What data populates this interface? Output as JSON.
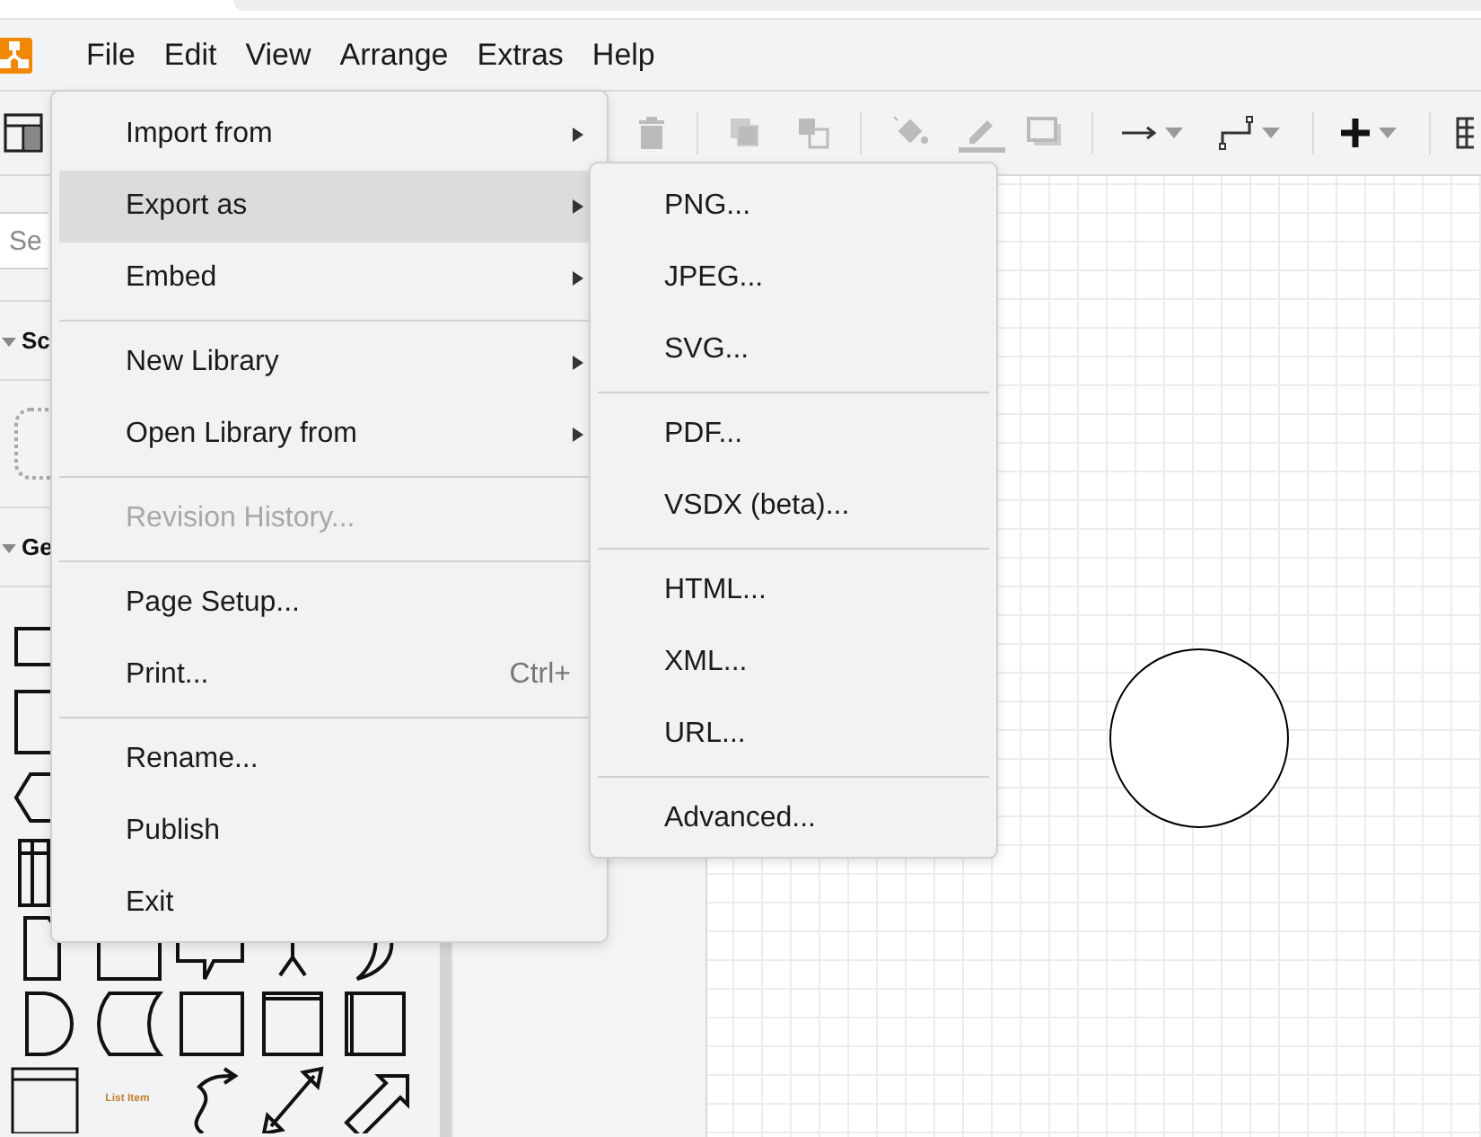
{
  "menubar": {
    "items": [
      {
        "label": "File"
      },
      {
        "label": "Edit"
      },
      {
        "label": "View"
      },
      {
        "label": "Arrange"
      },
      {
        "label": "Extras"
      },
      {
        "label": "Help"
      }
    ]
  },
  "sidebar": {
    "search": {
      "placeholder": "Se"
    },
    "sections": [
      {
        "title": "Sc",
        "expanded": true
      },
      {
        "title": "Ge",
        "expanded": true
      }
    ],
    "shape_label": "List Item"
  },
  "file_menu": {
    "items": [
      {
        "kind": "item",
        "label": "Import from",
        "submenu": true,
        "selected": false,
        "disabled": false
      },
      {
        "kind": "item",
        "label": "Export as",
        "submenu": true,
        "selected": true,
        "disabled": false
      },
      {
        "kind": "item",
        "label": "Embed",
        "submenu": true,
        "selected": false,
        "disabled": false
      },
      {
        "kind": "divider"
      },
      {
        "kind": "item",
        "label": "New Library",
        "submenu": true,
        "selected": false,
        "disabled": false
      },
      {
        "kind": "item",
        "label": "Open Library from",
        "submenu": true,
        "selected": false,
        "disabled": false
      },
      {
        "kind": "divider"
      },
      {
        "kind": "item",
        "label": "Revision History...",
        "submenu": false,
        "selected": false,
        "disabled": true
      },
      {
        "kind": "divider"
      },
      {
        "kind": "item",
        "label": "Page Setup...",
        "submenu": false,
        "selected": false,
        "disabled": false
      },
      {
        "kind": "item",
        "label": "Print...",
        "shortcut": "Ctrl+",
        "submenu": false,
        "selected": false,
        "disabled": false
      },
      {
        "kind": "divider"
      },
      {
        "kind": "item",
        "label": "Rename...",
        "submenu": false,
        "selected": false,
        "disabled": false
      },
      {
        "kind": "item",
        "label": "Publish",
        "submenu": false,
        "selected": false,
        "disabled": false
      },
      {
        "kind": "item",
        "label": "Exit",
        "submenu": false,
        "selected": false,
        "disabled": false
      }
    ]
  },
  "export_menu": {
    "items": [
      {
        "kind": "item",
        "label": "PNG...",
        "selected": false
      },
      {
        "kind": "item",
        "label": "JPEG...",
        "selected": false
      },
      {
        "kind": "item",
        "label": "SVG...",
        "selected": false
      },
      {
        "kind": "divider"
      },
      {
        "kind": "item",
        "label": "PDF...",
        "selected": false
      },
      {
        "kind": "item",
        "label": "VSDX (beta)...",
        "selected": false
      },
      {
        "kind": "divider"
      },
      {
        "kind": "item",
        "label": "HTML...",
        "selected": false
      },
      {
        "kind": "item",
        "label": "XML...",
        "selected": false
      },
      {
        "kind": "item",
        "label": "URL...",
        "selected": false
      },
      {
        "kind": "divider"
      },
      {
        "kind": "item",
        "label": "Advanced...",
        "selected": false
      }
    ]
  }
}
